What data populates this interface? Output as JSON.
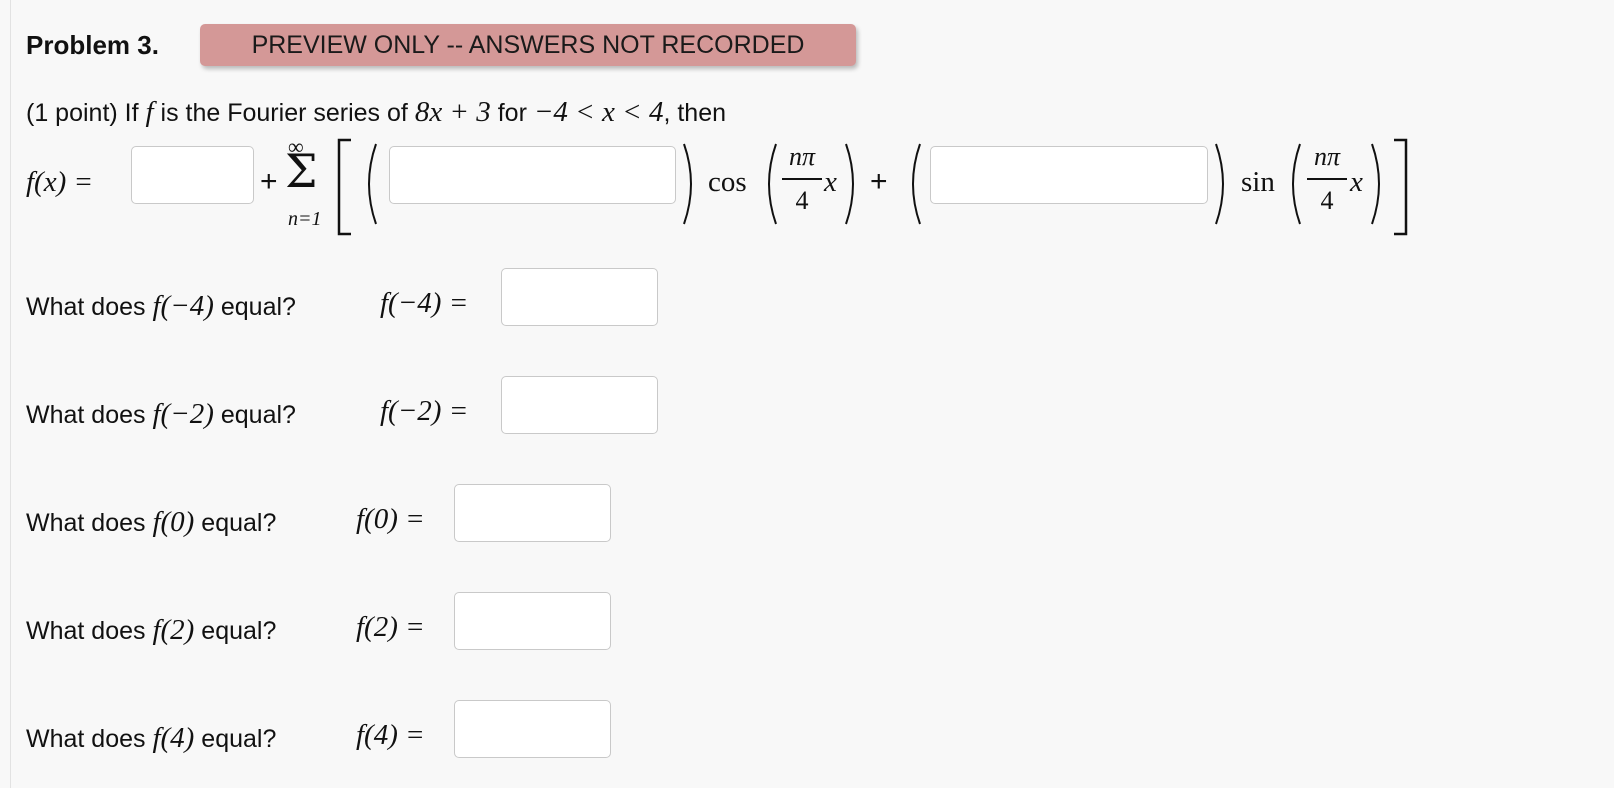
{
  "problem": {
    "title": "Problem 3.",
    "badge": "PREVIEW ONLY -- ANSWERS NOT RECORDED",
    "intro": {
      "prefix": "(1 point) If",
      "fn": "f",
      "mid": "is the Fourier series of",
      "expr": "8x + 3",
      "for": "for",
      "interval": "−4 < x < 4",
      "suffix": ", then"
    }
  },
  "series": {
    "lhs": "f(x) =",
    "plus": "+",
    "sigma": "Σ",
    "upper": "∞",
    "lower": "n=1",
    "cos": "cos",
    "sin": "sin",
    "frac_num": "nπ",
    "frac_den": "4",
    "x": "x"
  },
  "questions": [
    {
      "question": "What does",
      "fn": "f(−4)",
      "tail": "equal?",
      "lhs": "f(−4) ="
    },
    {
      "question": "What does",
      "fn": "f(−2)",
      "tail": "equal?",
      "lhs": "f(−2) ="
    },
    {
      "question": "What does",
      "fn": "f(0)",
      "tail": "equal?",
      "lhs": "f(0) ="
    },
    {
      "question": "What does",
      "fn": "f(2)",
      "tail": "equal?",
      "lhs": "f(2) ="
    },
    {
      "question": "What does",
      "fn": "f(4)",
      "tail": "equal?",
      "lhs": "f(4) ="
    }
  ],
  "inputs": {
    "a0": "",
    "an": "",
    "bn": "",
    "q1": "",
    "q2": "",
    "q3": "",
    "q4": "",
    "q5": ""
  },
  "colors": {
    "badge": "#d49897",
    "background": "#f8f8f8",
    "input_border": "#c9c9c9"
  }
}
